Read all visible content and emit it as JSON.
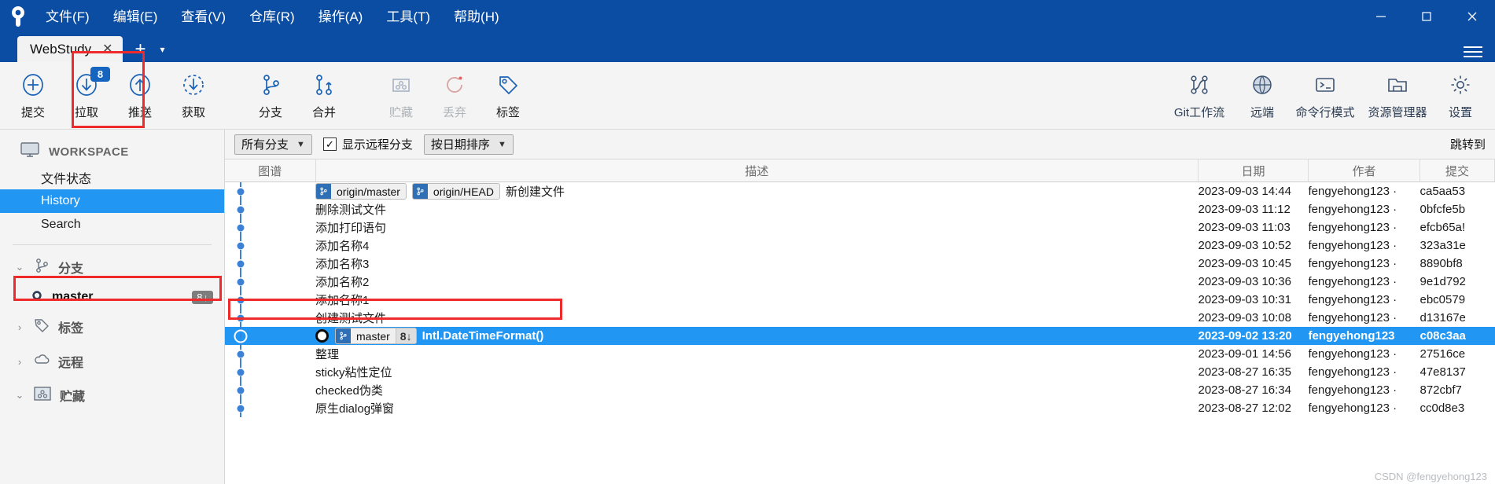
{
  "window": {
    "menu": [
      "文件(F)",
      "编辑(E)",
      "查看(V)",
      "仓库(R)",
      "操作(A)",
      "工具(T)",
      "帮助(H)"
    ],
    "minimize": "—",
    "maximize": "□",
    "close": "✕",
    "title_bar_color": "#0b4da2"
  },
  "tabs": {
    "items": [
      {
        "label": "WebStudy",
        "close": "✕"
      }
    ],
    "new_tab": "+",
    "chevron": "▾"
  },
  "toolbar": {
    "left": [
      {
        "label": "提交",
        "icon": "plus-circle-icon",
        "disabled": false,
        "badge": null
      },
      {
        "label": "拉取",
        "icon": "pull-down-circle-icon",
        "disabled": false,
        "badge": "8"
      },
      {
        "label": "推送",
        "icon": "push-up-circle-icon",
        "disabled": false,
        "badge": null
      },
      {
        "label": "获取",
        "icon": "fetch-dashed-circle-icon",
        "disabled": false,
        "badge": null
      },
      {
        "label": "分支",
        "icon": "branch-icon",
        "disabled": false,
        "badge": null
      },
      {
        "label": "合并",
        "icon": "merge-icon",
        "disabled": false,
        "badge": null
      },
      {
        "label": "贮藏",
        "icon": "stash-box-icon",
        "disabled": true,
        "badge": null
      },
      {
        "label": "丢弃",
        "icon": "discard-refresh-icon",
        "disabled": true,
        "badge": null
      },
      {
        "label": "标签",
        "icon": "tag-icon",
        "disabled": false,
        "badge": null
      }
    ],
    "right": [
      {
        "label": "Git工作流",
        "icon": "git-flow-icon"
      },
      {
        "label": "远端",
        "icon": "globe-icon"
      },
      {
        "label": "命令行模式",
        "icon": "terminal-icon"
      },
      {
        "label": "资源管理器",
        "icon": "folder-explorer-icon"
      },
      {
        "label": "设置",
        "icon": "gear-icon"
      }
    ],
    "highlight_color": "#ee2a2a"
  },
  "sidebar": {
    "workspace_label": "WORKSPACE",
    "nav": [
      {
        "label": "文件状态",
        "active": false
      },
      {
        "label": "History",
        "active": true
      },
      {
        "label": "Search",
        "active": false
      }
    ],
    "groups": [
      {
        "label": "分支",
        "icon": "branch-icon",
        "expanded": true,
        "chevron": "⌄",
        "rows": [
          {
            "label": "master",
            "badge": "8",
            "badge_arrow": "↓",
            "highlighted": true
          }
        ]
      },
      {
        "label": "标签",
        "icon": "tag-icon",
        "expanded": false,
        "chevron": "›",
        "rows": []
      },
      {
        "label": "远程",
        "icon": "cloud-icon",
        "expanded": false,
        "chevron": "›",
        "rows": []
      },
      {
        "label": "贮藏",
        "icon": "stash-box-icon",
        "expanded": true,
        "chevron": "⌄",
        "rows": []
      }
    ]
  },
  "filterbar": {
    "branch_filter": "所有分支",
    "show_remote_label": "显示远程分支",
    "show_remote_checked": true,
    "checkmark": "✓",
    "sort": "按日期排序",
    "jump_to": "跳转到"
  },
  "table": {
    "headers": [
      "图谱",
      "描述",
      "日期",
      "作者",
      "提交"
    ],
    "rows": [
      {
        "refs": [
          {
            "name": "origin/master",
            "count": null
          },
          {
            "name": "origin/HEAD",
            "count": null
          }
        ],
        "head": false,
        "message": "新创建文件",
        "date": "2023-09-03 14:44",
        "author": "fengyehong123 ·",
        "hash": "ca5aa53",
        "selected": false
      },
      {
        "refs": [],
        "head": false,
        "message": "删除测试文件",
        "date": "2023-09-03 11:12",
        "author": "fengyehong123 ·",
        "hash": "0bfcfe5b",
        "selected": false
      },
      {
        "refs": [],
        "head": false,
        "message": "添加打印语句",
        "date": "2023-09-03 11:03",
        "author": "fengyehong123 ·",
        "hash": "efcb65a!",
        "selected": false
      },
      {
        "refs": [],
        "head": false,
        "message": "添加名称4",
        "date": "2023-09-03 10:52",
        "author": "fengyehong123 ·",
        "hash": "323a31e",
        "selected": false
      },
      {
        "refs": [],
        "head": false,
        "message": "添加名称3",
        "date": "2023-09-03 10:45",
        "author": "fengyehong123 ·",
        "hash": "8890bf8",
        "selected": false
      },
      {
        "refs": [],
        "head": false,
        "message": "添加名称2",
        "date": "2023-09-03 10:36",
        "author": "fengyehong123 ·",
        "hash": "9e1d792",
        "selected": false
      },
      {
        "refs": [],
        "head": false,
        "message": "添加名称1",
        "date": "2023-09-03 10:31",
        "author": "fengyehong123 ·",
        "hash": "ebc0579",
        "selected": false
      },
      {
        "refs": [],
        "head": false,
        "message": "创建测试文件",
        "date": "2023-09-03 10:08",
        "author": "fengyehong123 ·",
        "hash": "d13167e",
        "selected": false
      },
      {
        "refs": [
          {
            "name": "master",
            "count": "8↓"
          }
        ],
        "head": true,
        "message": "Intl.DateTimeFormat()",
        "date": "2023-09-02 13:20",
        "author": "fengyehong123",
        "hash": "c08c3aa",
        "selected": true
      },
      {
        "refs": [],
        "head": false,
        "message": "整理",
        "date": "2023-09-01 14:56",
        "author": "fengyehong123 ·",
        "hash": "27516ce",
        "selected": false
      },
      {
        "refs": [],
        "head": false,
        "message": "sticky粘性定位",
        "date": "2023-08-27 16:35",
        "author": "fengyehong123 ·",
        "hash": "47e8137",
        "selected": false
      },
      {
        "refs": [],
        "head": false,
        "message": "checked伪类",
        "date": "2023-08-27 16:34",
        "author": "fengyehong123 ·",
        "hash": "872cbf7",
        "selected": false
      },
      {
        "refs": [],
        "head": false,
        "message": "原生dialog弹窗",
        "date": "2023-08-27 12:02",
        "author": "fengyehong123 ·",
        "hash": "cc0d8e3",
        "selected": false
      }
    ]
  },
  "watermark": "CSDN @fengyehong123"
}
